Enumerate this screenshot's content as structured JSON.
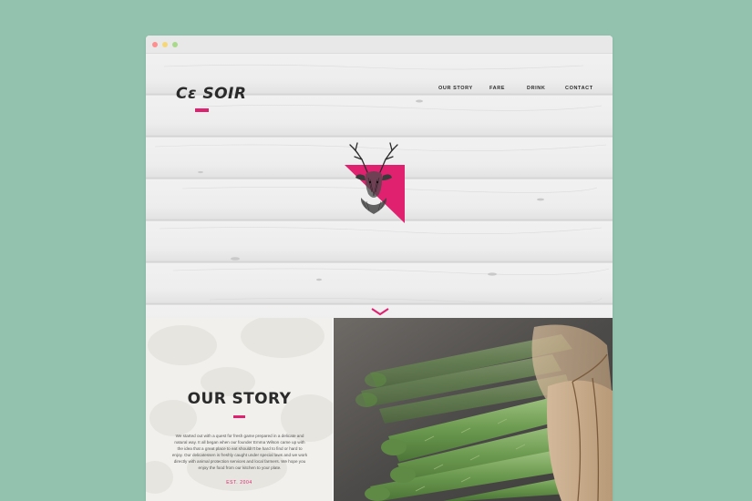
{
  "colors": {
    "background": "#93c2af",
    "accent": "#e0216f",
    "text_dark": "#2a2a2a"
  },
  "window": {
    "controls": [
      "close-dot",
      "minimize-dot",
      "maximize-dot"
    ]
  },
  "header": {
    "logo_text": "Cε SOIR",
    "nav": [
      {
        "label": "OUR STORY"
      },
      {
        "label": "FARE"
      },
      {
        "label": "DRINK"
      },
      {
        "label": "CONTACT"
      }
    ]
  },
  "hero": {
    "emblem_icon": "stag-head-icon",
    "scroll_icon": "chevron-down-icon"
  },
  "story": {
    "title": "OUR STORY",
    "body": "We started out with a quest for fresh game prepared in a delicate and natural way. It all began when our founder Emma Wilson came up with the idea that a great place to eat shouldn't be hard to find or hard to enjoy. Our delicatessen is freshly caught under special laws and we work directly with animal protection services and local farmers. We hope you enjoy the food from our kitchen to your plate.",
    "established": "EST. 2004"
  },
  "photo": {
    "subject": "asparagus-bundle-image"
  }
}
